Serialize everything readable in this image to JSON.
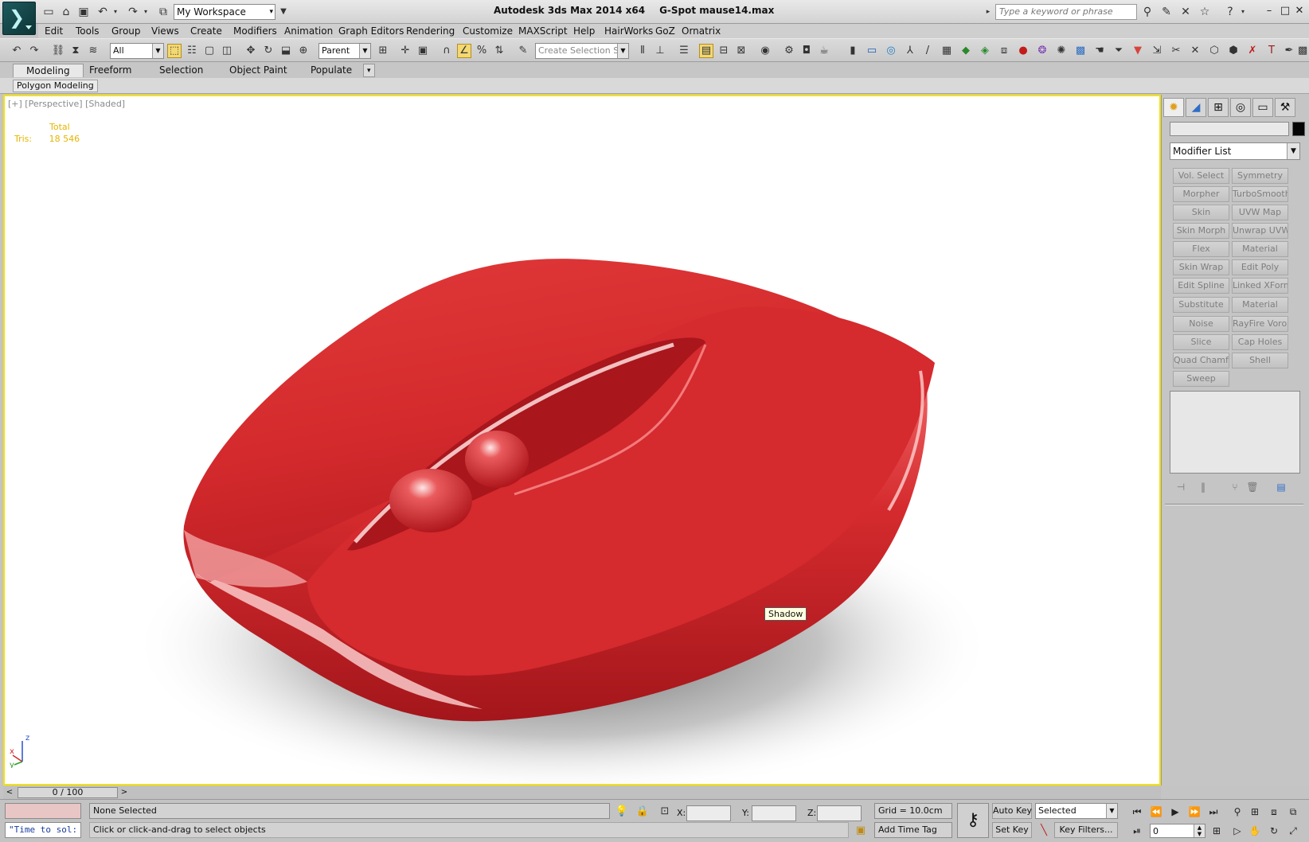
{
  "titlebar": {
    "workspace": "My Workspace",
    "app": "Autodesk 3ds Max  2014 x64",
    "file": "G-Spot mause14.max",
    "search_placeholder": "Type a keyword or phrase"
  },
  "menus": [
    "Edit",
    "Tools",
    "Group",
    "Views",
    "Create",
    "Modifiers",
    "Animation",
    "Graph Editors",
    "Rendering",
    "Customize",
    "MAXScript",
    "Help",
    "HairWorks",
    "GoZ",
    "Ornatrix"
  ],
  "toolbar": {
    "filter": "All",
    "coord": "Parent",
    "selection_set_placeholder": "Create Selection Se"
  },
  "ribbon": {
    "tabs": [
      "Modeling",
      "Freeform",
      "Selection",
      "Object Paint",
      "Populate"
    ],
    "panel": "Polygon Modeling"
  },
  "viewport": {
    "label": "[+] [Perspective] [Shaded]",
    "stats_header": "Total",
    "stats_label": "Tris:",
    "stats_value": "18 546",
    "tooltip": "Shadow",
    "axis": {
      "x": "x",
      "y": "y",
      "z": "z"
    },
    "colors": {
      "model": "#d8262b",
      "border": "#f4e10a"
    }
  },
  "command_panel": {
    "modifier_list": "Modifier List",
    "buttons": [
      [
        "Vol. Select",
        "Symmetry"
      ],
      [
        "Morpher",
        "TurboSmooth"
      ],
      [
        "Skin",
        "UVW Map"
      ],
      [
        "Skin Morph",
        "Unwrap UVW"
      ],
      [
        "Flex",
        "Material"
      ],
      [
        "Skin Wrap",
        "Edit Poly"
      ],
      [
        "Edit Spline",
        "Linked XForm"
      ],
      [
        "Substitute",
        "Material"
      ],
      [
        "Noise",
        "RayFire Voronoi"
      ],
      [
        "Slice",
        "Cap Holes"
      ],
      [
        "Quad Chamfer",
        "Shell"
      ],
      [
        "Sweep",
        ""
      ]
    ]
  },
  "timeline": {
    "frame": "0 / 100",
    "prev": "<",
    "next": ">"
  },
  "status": {
    "script": "\"Time to sol:",
    "selection": "None Selected",
    "prompt": "Click or click-and-drag to select objects",
    "x_label": "X:",
    "y_label": "Y:",
    "z_label": "Z:",
    "grid": "Grid = 10.0cm",
    "add_time_tag": "Add Time Tag",
    "auto_key": "Auto Key",
    "set_key": "Set Key",
    "key_mode": "Selected",
    "key_filters": "Key Filters...",
    "current_frame": "0"
  }
}
